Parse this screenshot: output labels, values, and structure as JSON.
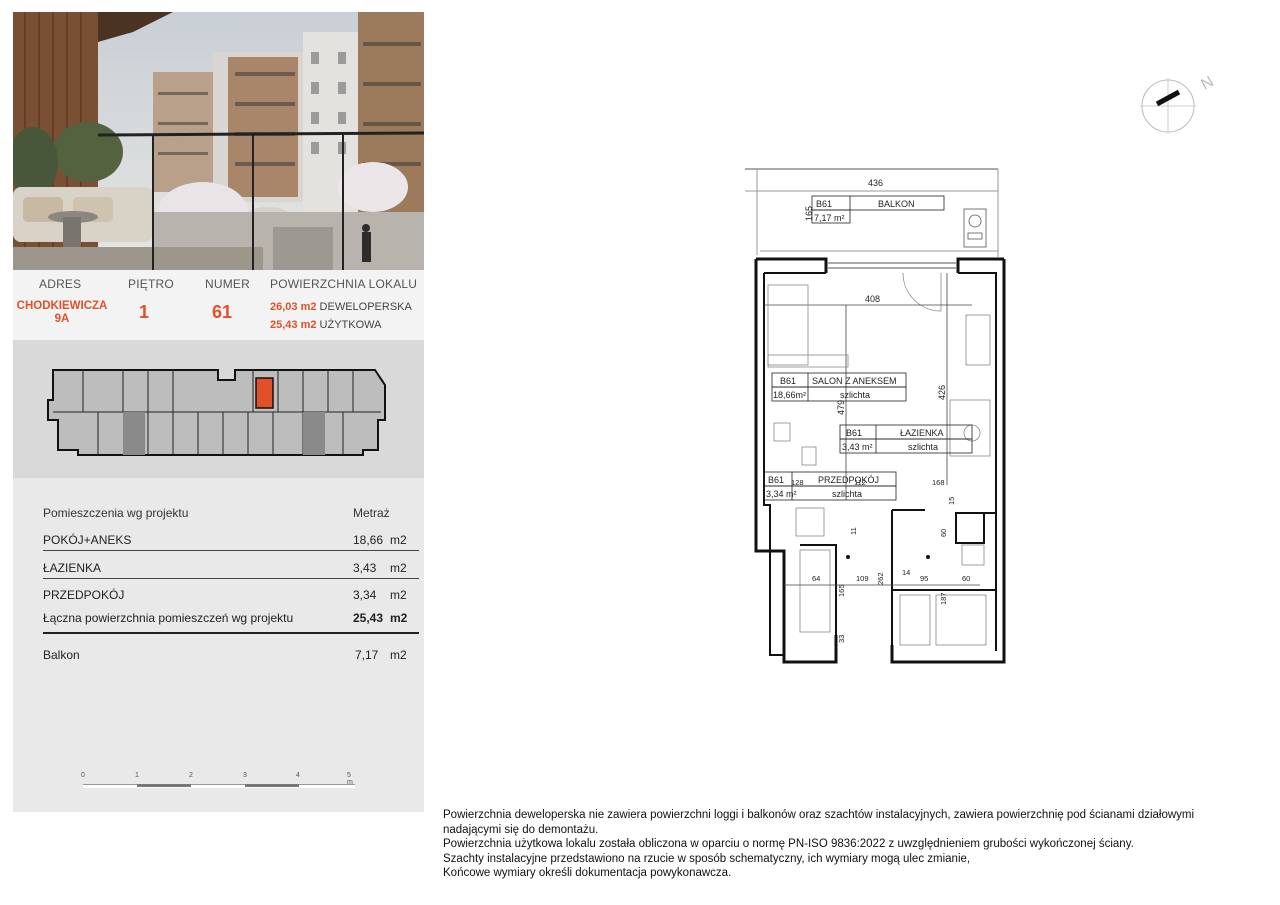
{
  "address": {
    "header": "ADRES",
    "line1": "CHODKIEWICZA",
    "line2": "9A"
  },
  "floor": {
    "header": "PIĘTRO",
    "value": "1"
  },
  "number": {
    "header": "NUMER",
    "value": "61"
  },
  "area": {
    "header": "POWIERZCHNIA LOKALU",
    "dev_value": "26,03 m2",
    "dev_label": "DEWELOPERSKA",
    "use_value": "25,43 m2",
    "use_label": "UŻYTKOWA"
  },
  "rooms": {
    "header_name": "Pomieszczenia wg projektu",
    "header_area": "Metraż",
    "items": [
      {
        "name": "POKÓJ+ANEKS",
        "value": "18,66",
        "unit": "m2"
      },
      {
        "name": "ŁAZIENKA",
        "value": "3,43",
        "unit": "m2"
      },
      {
        "name": "PRZEDPOKÓJ",
        "value": "3,34",
        "unit": "m2"
      }
    ],
    "total": {
      "name": "Łączna powierzchnia pomieszczeń wg projektu",
      "value": "25,43",
      "unit": "m2"
    },
    "balcony": {
      "name": "Balkon",
      "value": "7,17",
      "unit": "m2"
    }
  },
  "scale_labels": [
    "0",
    "1",
    "2",
    "3",
    "4",
    "5 m"
  ],
  "plan": {
    "balkon": {
      "code": "B61",
      "name": "BALKON",
      "area": "7,17 m²"
    },
    "salon": {
      "code": "B61",
      "name": "SALON Z ANEKSEM",
      "area": "18,66m²",
      "finish": "szlichta"
    },
    "lazienka": {
      "code": "B61",
      "name": "ŁAZIENKA",
      "area": "3,43 m²",
      "finish": "szlichta"
    },
    "przedpokoj": {
      "code": "B61",
      "name": "PRZEDPOKÓJ",
      "area": "3,34 m²",
      "finish": "szlichta"
    },
    "dims": {
      "d436": "436",
      "d165": "165",
      "d408": "408",
      "d426": "426",
      "d479": "479",
      "d128": "128",
      "d112": "112",
      "d168": "168",
      "d11": "11",
      "d60a": "60",
      "d15": "15",
      "d64": "64",
      "d109": "109",
      "d14": "14",
      "d95": "95",
      "d60b": "60",
      "d165b": "165",
      "d262": "262",
      "d187": "187",
      "d33": "33"
    }
  },
  "footnote": [
    "Powierzchnia deweloperska nie zawiera powierzchni loggi i balkonów oraz szachtów instalacyjnych, zawiera powierzchnię pod ścianami działowymi",
    "nadającymi się do demontażu.",
    "Powierzchnia użytkowa lokalu została obliczona w oparciu o normę PN-ISO 9836:2022 z uwzględnieniem grubości wykończonej ściany.",
    "Szachty instalacyjne przedstawiono na rzucie w sposób schematyczny, ich wymiary mogą ulec zmianie,",
    "Końcowe wymiary określi dokumentacja powykonawcza."
  ],
  "colors": {
    "accent": "#e0502a",
    "panel": "#ececec",
    "keyplan_bg": "#d9d9d9"
  }
}
